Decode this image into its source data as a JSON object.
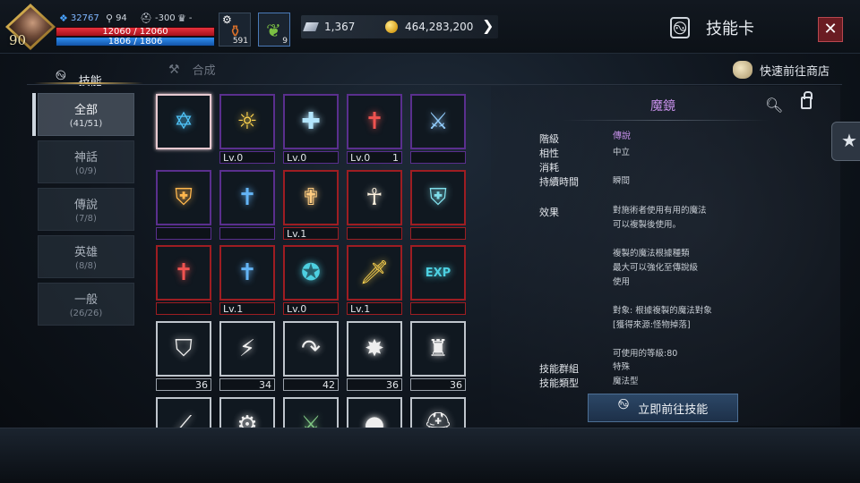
{
  "player": {
    "level": "90",
    "stat1": "32767",
    "stat2": "94",
    "stat3": "-300",
    "stat4": "-",
    "hp": "12060 / 12060",
    "hp_fraction": 1.0,
    "mp": "1806 / 1806",
    "mp_fraction": 1.0
  },
  "quick_slots": [
    {
      "name": "potion-icon",
      "count": "591"
    },
    {
      "name": "leaf-icon",
      "count": "9"
    }
  ],
  "currency": {
    "crystal": "1,367",
    "gold": "464,283,200"
  },
  "window": {
    "title": "技能卡",
    "close": "✕"
  },
  "tabs": [
    {
      "label": "技能",
      "active": true
    },
    {
      "label": "合成",
      "active": false
    }
  ],
  "shop_link": "快速前往商店",
  "categories": [
    {
      "name": "全部",
      "count": "(41/51)",
      "active": true
    },
    {
      "name": "神話",
      "count": "(0/9)",
      "active": false
    },
    {
      "name": "傳說",
      "count": "(7/8)",
      "active": false
    },
    {
      "name": "英雄",
      "count": "(8/8)",
      "active": false
    },
    {
      "name": "一般",
      "count": "(26/26)",
      "active": false
    }
  ],
  "skills": [
    {
      "icon": "hexagram-icon",
      "rarity": "selected",
      "lv": "",
      "qty": "",
      "color": "#4fc3f7"
    },
    {
      "icon": "sun-ring-icon",
      "rarity": "purple",
      "lv": "Lv.0",
      "qty": "",
      "color": "#ffd54f"
    },
    {
      "icon": "cross-shield-icon",
      "rarity": "purple",
      "lv": "Lv.0",
      "qty": "",
      "color": "#b3e5fc"
    },
    {
      "icon": "red-tome-icon",
      "rarity": "purple",
      "lv": "Lv.0",
      "qty": "1",
      "color": "#ef5350"
    },
    {
      "icon": "sword-strike-icon",
      "rarity": "purple",
      "lv": "",
      "qty": "",
      "color": "#90caf9"
    },
    {
      "icon": "ornate-shield-icon",
      "rarity": "purple",
      "lv": "",
      "qty": "",
      "color": "#ffb74d"
    },
    {
      "icon": "blue-tome-icon",
      "rarity": "purple",
      "lv": "",
      "qty": "",
      "color": "#64b5f6"
    },
    {
      "icon": "holy-cross-icon",
      "rarity": "red",
      "lv": "Lv.1",
      "qty": "",
      "color": "#ffcc80"
    },
    {
      "icon": "praying-hands-icon",
      "rarity": "red",
      "lv": "",
      "qty": "",
      "color": "#fff3e0"
    },
    {
      "icon": "crest-shield-icon",
      "rarity": "red",
      "lv": "",
      "qty": "",
      "color": "#80deea"
    },
    {
      "icon": "red-tome-icon",
      "rarity": "red",
      "lv": "",
      "qty": "",
      "color": "#ef5350"
    },
    {
      "icon": "blue-tome-icon",
      "rarity": "red",
      "lv": "Lv.1",
      "qty": "",
      "color": "#64b5f6"
    },
    {
      "icon": "star-ring-icon",
      "rarity": "red",
      "lv": "Lv.0",
      "qty": "",
      "color": "#4dd0e1"
    },
    {
      "icon": "flame-sword-icon",
      "rarity": "red",
      "lv": "Lv.1",
      "qty": "",
      "color": "#ffd54f"
    },
    {
      "icon": "exp-badge-icon",
      "rarity": "red",
      "lv": "",
      "qty": "",
      "color": "#4dd0e1"
    },
    {
      "icon": "shield-slash-icon",
      "rarity": "white",
      "lv": "",
      "qty": "36",
      "color": "#eeeeee"
    },
    {
      "icon": "lightning-icon",
      "rarity": "white",
      "lv": "",
      "qty": "34",
      "color": "#eeeeee"
    },
    {
      "icon": "curved-arrow-icon",
      "rarity": "white",
      "lv": "",
      "qty": "42",
      "color": "#eeeeee"
    },
    {
      "icon": "burst-icon",
      "rarity": "white",
      "lv": "",
      "qty": "36",
      "color": "#eeeeee"
    },
    {
      "icon": "altar-icon",
      "rarity": "white",
      "lv": "",
      "qty": "36",
      "color": "#eeeeee"
    },
    {
      "icon": "blade-icon",
      "rarity": "white",
      "lv": "",
      "qty": "",
      "color": "#eeeeee"
    },
    {
      "icon": "gear-icon",
      "rarity": "white",
      "lv": "",
      "qty": "",
      "color": "#eeeeee"
    },
    {
      "icon": "green-sword-icon",
      "rarity": "white",
      "lv": "",
      "qty": "",
      "color": "#81c784"
    },
    {
      "icon": "orb-icon",
      "rarity": "white",
      "lv": "",
      "qty": "",
      "color": "#eeeeee"
    },
    {
      "icon": "helmet-icon",
      "rarity": "white",
      "lv": "",
      "qty": "",
      "color": "#eeeeee"
    }
  ],
  "detail": {
    "name": "魔鏡",
    "rows": [
      {
        "key": "階級",
        "value": "傳說"
      },
      {
        "key": "相性",
        "value": "中立"
      },
      {
        "key": "消耗",
        "value": ""
      },
      {
        "key": "持續時間",
        "value": "瞬間"
      },
      {
        "key": "效果",
        "value": "對施術者使用有用的魔法\n可以複製後使用。\n\n複製的魔法根據種類\n最大可以強化至傳說級\n使用\n\n對象: 根據複製的魔法對象\n[獲得來源:怪物掉落]\n\n可使用的等級:80"
      },
      {
        "key": "技能群組",
        "value": "特殊"
      },
      {
        "key": "技能類型",
        "value": "魔法型"
      }
    ],
    "go_button": "立即前往技能"
  }
}
